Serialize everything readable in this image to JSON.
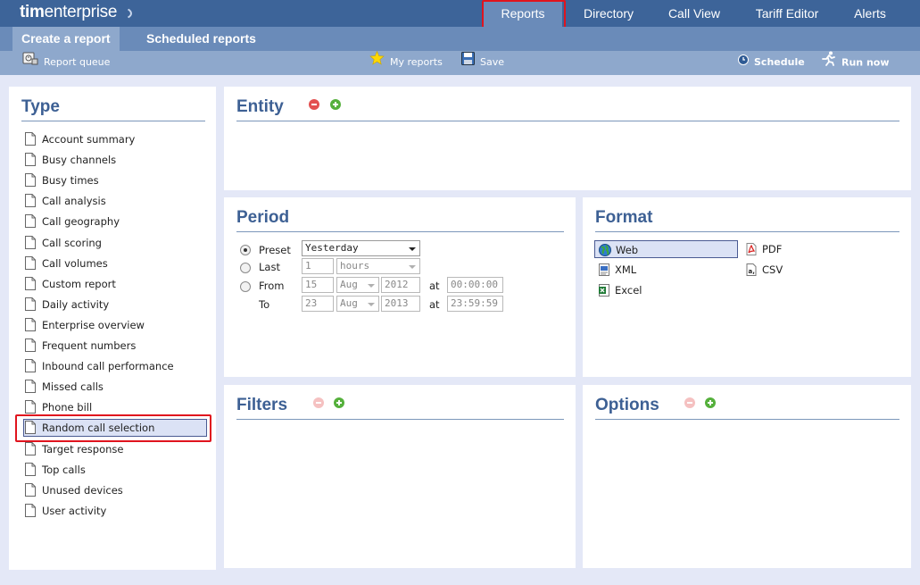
{
  "app": {
    "logo_text_bold": "tim",
    "logo_text_rest": "enterprise"
  },
  "topnav": {
    "items": [
      "Reports",
      "Directory",
      "Call View",
      "Tariff Editor",
      "Alerts"
    ]
  },
  "subnav": {
    "tabs": [
      "Create a report",
      "Scheduled reports"
    ]
  },
  "toolbar": {
    "report_queue": "Report queue",
    "my_reports": "My reports",
    "save": "Save",
    "schedule": "Schedule",
    "run_now": "Run now"
  },
  "type_panel": {
    "title": "Type",
    "items": [
      "Account summary",
      "Busy channels",
      "Busy times",
      "Call analysis",
      "Call geography",
      "Call scoring",
      "Call volumes",
      "Custom report",
      "Daily activity",
      "Enterprise overview",
      "Frequent numbers",
      "Inbound call performance",
      "Missed calls",
      "Phone bill",
      "Random call selection",
      "Target response",
      "Top calls",
      "Unused devices",
      "User activity"
    ],
    "selected": "Random call selection"
  },
  "entity_panel": {
    "title": "Entity"
  },
  "period_panel": {
    "title": "Period",
    "preset_label": "Preset",
    "preset_value": "Yesterday",
    "last_label": "Last",
    "last_value": "1",
    "last_unit": "hours",
    "from_label": "From",
    "from_day": "15",
    "from_month": "Aug",
    "from_year": "2012",
    "from_time": "00:00:00",
    "to_label": "To",
    "to_day": "23",
    "to_month": "Aug",
    "to_year": "2013",
    "to_time": "23:59:59",
    "at_label": "at"
  },
  "format_panel": {
    "title": "Format",
    "options": [
      "Web",
      "PDF",
      "XML",
      "CSV",
      "Excel"
    ],
    "selected": "Web"
  },
  "filters_panel": {
    "title": "Filters"
  },
  "options_panel": {
    "title": "Options"
  },
  "colors": {
    "topbar": "#3d6499",
    "subbar": "#6a8bb9",
    "toolbar": "#8ea8cc",
    "background": "#e4e8f7",
    "title": "#3d6094",
    "highlight": "#e0141e"
  }
}
